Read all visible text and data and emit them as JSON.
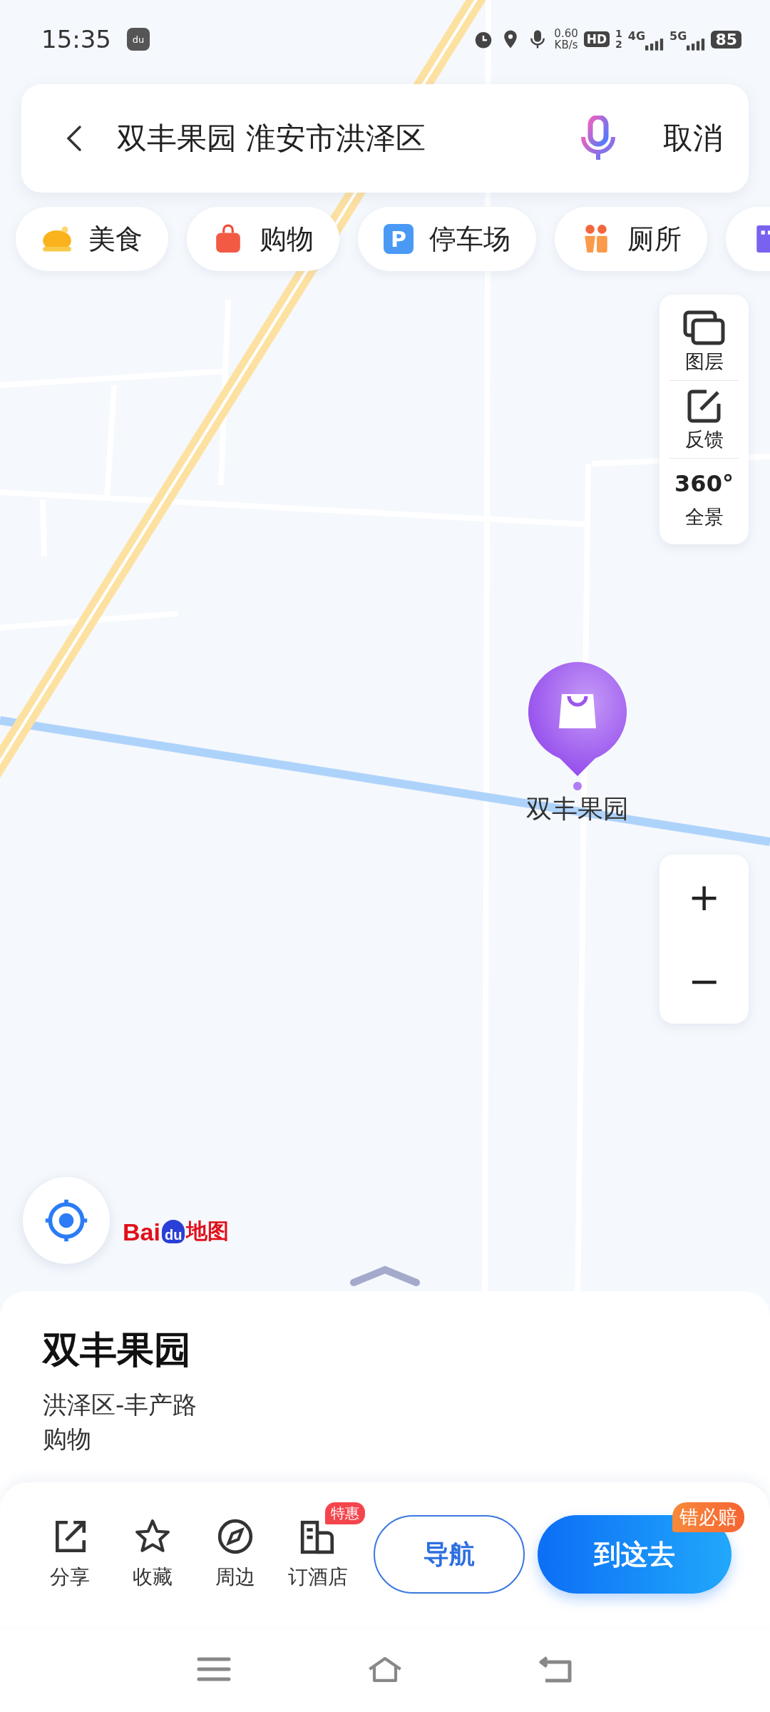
{
  "status_bar": {
    "time": "15:35",
    "app_badge": "du",
    "net_speed": "0.60",
    "net_speed_unit": "KB/s",
    "hd": "HD",
    "sim_labels": [
      "1",
      "2"
    ],
    "networks": [
      "4G",
      "5G"
    ],
    "battery": "85"
  },
  "search_bar": {
    "query": "双丰果园 淮安市洪泽区",
    "cancel": "取消"
  },
  "categories": [
    {
      "label": "美食",
      "kind": "food"
    },
    {
      "label": "购物",
      "kind": "shopping"
    },
    {
      "label": "停车场",
      "kind": "parking",
      "icon_text": "P"
    },
    {
      "label": "厕所",
      "kind": "toilet"
    },
    {
      "kind": "building"
    }
  ],
  "map_tools": [
    {
      "label": "图层",
      "kind": "layers"
    },
    {
      "label": "反馈",
      "kind": "feedback"
    },
    {
      "label": "全景",
      "kind": "panorama",
      "icon_text": "360°"
    }
  ],
  "zoom": {
    "in": "+",
    "out": "−"
  },
  "map": {
    "marker_label": "双丰果园"
  },
  "logo": {
    "prefix": "Bai",
    "paw": "du",
    "suffix": "地图"
  },
  "place": {
    "name": "双丰果园",
    "address": "洪泽区-丰产路",
    "category": "购物"
  },
  "actions": [
    {
      "label": "分享",
      "kind": "share"
    },
    {
      "label": "收藏",
      "kind": "favorite"
    },
    {
      "label": "周边",
      "kind": "nearby"
    },
    {
      "label": "订酒店",
      "kind": "hotel",
      "badge": "特惠"
    }
  ],
  "navigate": "导航",
  "go": {
    "label": "到这去",
    "badge": "错必赔"
  }
}
